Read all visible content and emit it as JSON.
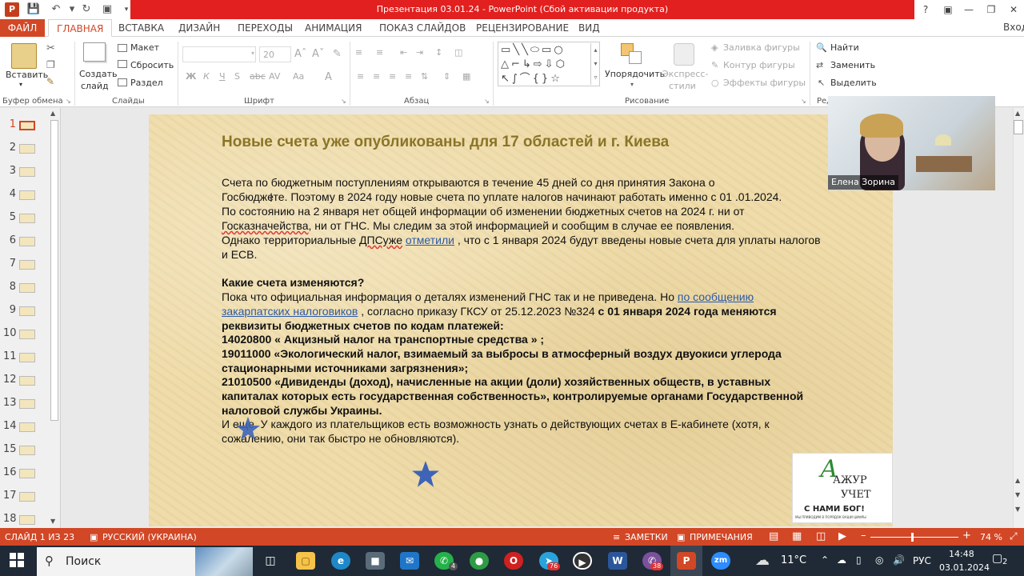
{
  "window": {
    "title": "Презентация 03.01.24 - PowerPoint (Сбой активации продукта)",
    "signin": "Вход"
  },
  "tabs": [
    "ФАЙЛ",
    "ГЛАВНАЯ",
    "ВСТАВКА",
    "ДИЗАЙН",
    "ПЕРЕХОДЫ",
    "АНИМАЦИЯ",
    "ПОКАЗ СЛАЙДОВ",
    "РЕЦЕНЗИРОВАНИЕ",
    "ВИД"
  ],
  "ribbon": {
    "paste": "Вставить",
    "new_slide_1": "Создать",
    "new_slide_2": "слайд",
    "layout": "Макет",
    "reset": "Сбросить",
    "section": "Раздел",
    "font_size": "20",
    "arrange": "Упорядочить",
    "quick_styles_1": "Экспресс-",
    "quick_styles_2": "стили",
    "shape_fill": "Заливка фигуры",
    "shape_outline": "Контур фигуры",
    "shape_effects": "Эффекты фигуры",
    "find": "Найти",
    "replace": "Заменить",
    "select": "Выделить",
    "groups": {
      "clipboard": "Буфер обмена",
      "slides": "Слайды",
      "font": "Шрифт",
      "paragraph": "Абзац",
      "drawing": "Рисование",
      "editing": "Ред"
    }
  },
  "thumbnails": [
    "1",
    "2",
    "3",
    "4",
    "5",
    "6",
    "7",
    "8",
    "9",
    "10",
    "11",
    "12",
    "13",
    "14",
    "15",
    "16",
    "17",
    "18"
  ],
  "slide": {
    "title": "Новые счета уже опубликованы для 17 областей и г. Киева",
    "p1": [
      "Счета по бюджетным поступлениям открываются в течение 45 дней со дня принятия Закона о",
      "Госбюджете. Поэтому в 2024 году новые счета по уплате налогов начинают работать именно с 01 .01.2024.",
      "По состоянию на 2 января нет общей информации об изменении бюджетных счетов на 2024 г. ни от"
    ],
    "p1_l4_link": "Госказначейства",
    "p1_l4_rest": ", ни от ГНС. Мы следим за этой информацией и сообщим в случае ее появления.",
    "p1_l5_pre": "Однако территориальные ",
    "p1_l5_dps": "ДПСуже",
    "p1_l5_link": "отметили",
    "p1_l5_rest": " , что с 1 января 2024 будут введены новые счета для уплаты налогов",
    "p1_l6": "и ЕСВ.",
    "q": "Какие счета изменяются?",
    "p2_l1_pre": "Пока что официальная информация о деталях изменений ГНС так и не приведена. Но ",
    "p2_l1_link": "по сообщению",
    "p2_l2_link": "закарпатских налоговиков",
    "p2_l2_rest": " , согласно приказу ГКСУ от 25.12.2023 №324 ",
    "p2_l2_bold": "с 01 января 2024 года меняются",
    "bold_lines": [
      "реквизиты бюджетных счетов по кодам платежей:",
      "14020800  « Акцизный налог на транспортные средства » ;",
      "19011000 «Экологический налог, взимаемый за выбросы в атмосферный воздух двуокиси углерода",
      "стационарными источниками загрязнения»;",
      "21010500 «Дивиденды (доход), начисленные на акции (доли) хозяйственных обществ, в уставных",
      "капиталах которых есть государственная собственность», контролируемые органами Государственной",
      "налоговой службы Украины."
    ],
    "p3": [
      "И еще. У каждого из плательщиков есть возможность узнать о действующих счетах в Е-кабинете (хотя, к",
      "сожалению, они так быстро не обновляются)."
    ],
    "logo_text_1": "АЖУР",
    "logo_text_2": "УЧЕТ",
    "logo_text_3": "С НАМИ БОГ!",
    "logo_text_4": "МЫ ПРИВОДИМ В ПОРЯДОК ВАШИ ЦИФРЫ"
  },
  "webcam": {
    "name": "Елена Зорина"
  },
  "status": {
    "slide": "СЛАЙД 1 ИЗ 23",
    "lang": "РУССКИЙ (УКРАИНА)",
    "notes": "ЗАМЕТКИ",
    "comments": "ПРИМЕЧАНИЯ",
    "zoom": "74 %"
  },
  "taskbar": {
    "search": "Поиск",
    "temp": "11°C",
    "lang": "РУС",
    "time": "14:48",
    "date": "03.01.2024",
    "notif": "2",
    "badge_yandex": "76",
    "badge_viber": "38",
    "badge_whatsapp": "4"
  },
  "colors": {
    "accent": "#d24726",
    "title_red": "#e2201f",
    "slide_title": "#8a7427",
    "link": "#2b5aa6"
  }
}
